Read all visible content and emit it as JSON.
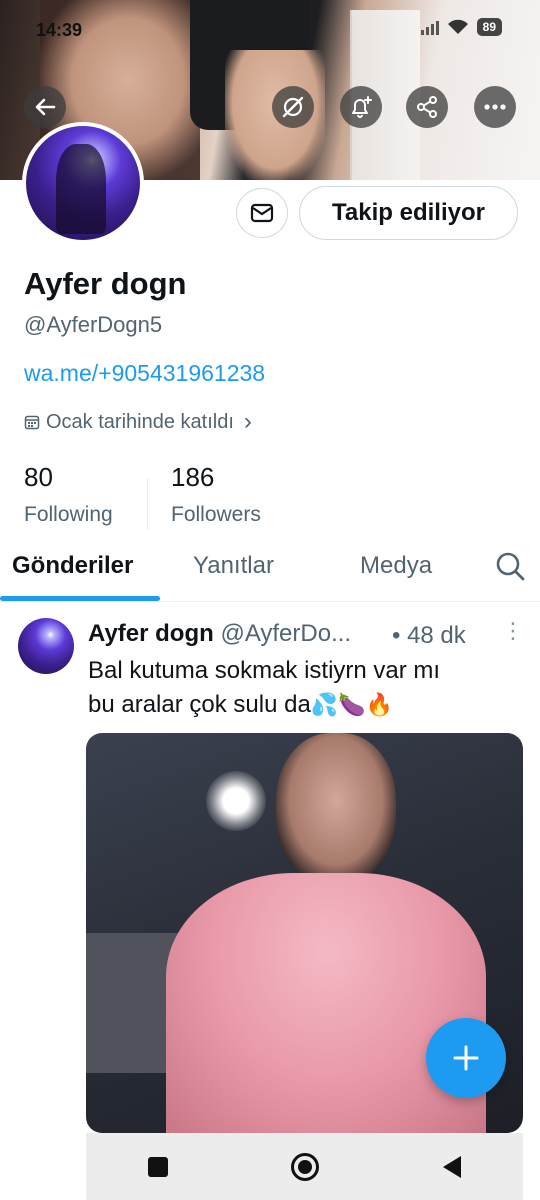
{
  "status_bar": {
    "time": "14:39",
    "battery": "89"
  },
  "banner_actions": {
    "back_icon": "arrow-left-icon",
    "grok_icon": "grok-icon",
    "notify_icon": "bell-plus-icon",
    "share_icon": "share-icon",
    "more_icon": "more-icon"
  },
  "profile": {
    "display_name": "Ayfer dogn",
    "handle": "@AyferDogn5",
    "website": "wa.me/+905431961238",
    "joined": "Ocak tarihinde katıldı",
    "joined_chevron": "›",
    "follow_button": "Takip ediliyor"
  },
  "stats": {
    "following_count": "80",
    "following_label": "Following",
    "followers_count": "186",
    "followers_label": "Followers"
  },
  "tabs": [
    {
      "label": "Gönderiler",
      "active": true
    },
    {
      "label": "Yanıtlar",
      "active": false
    },
    {
      "label": "Medya",
      "active": false
    }
  ],
  "tweet": {
    "name": "Ayfer dogn",
    "handle": "@AyferDo...",
    "time": "• 48 dk",
    "more": "⋮",
    "text_line1": "Bal kutuma sokmak istiyrn var mı",
    "text_line2": "bu aralar çok sulu da",
    "emojis": "💦🍆🔥"
  },
  "colors": {
    "accent": "#1d9bf0",
    "text": "#0f1419",
    "muted": "#536471"
  }
}
